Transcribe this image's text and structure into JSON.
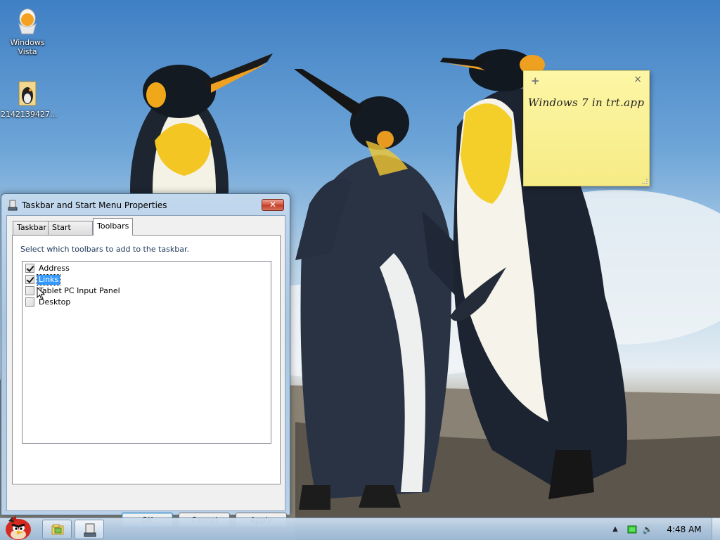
{
  "desktop": {
    "icons": [
      {
        "label": "Windows\nVista",
        "icon": "egg-cup-icon"
      },
      {
        "label": "2142139427...",
        "icon": "image-file-icon"
      }
    ]
  },
  "sticky_note": {
    "add_symbol": "+",
    "close_symbol": "×",
    "text": "Windows 7 in trt.app"
  },
  "dialog": {
    "title": "Taskbar and Start Menu Properties",
    "close_symbol": "✕",
    "tabs": [
      {
        "label": "Taskbar"
      },
      {
        "label": "Start Menu"
      },
      {
        "label": "Toolbars",
        "active": true
      }
    ],
    "instruction": "Select which toolbars to add to the taskbar.",
    "toolbars": [
      {
        "label": "Address",
        "checked": true,
        "selected": false
      },
      {
        "label": "Links",
        "checked": true,
        "selected": true
      },
      {
        "label": "Tablet PC Input Panel",
        "checked": false,
        "selected": false
      },
      {
        "label": "Desktop",
        "checked": false,
        "selected": false
      }
    ],
    "buttons": {
      "ok": "OK",
      "cancel": "Cancel",
      "apply": "Apply"
    }
  },
  "taskbar": {
    "start_icon": "angry-bird-icon",
    "tasks": [
      {
        "icon": "windows-explorer-icon"
      },
      {
        "icon": "taskbar-properties-icon",
        "active": true
      }
    ],
    "tray": {
      "arrow": "▲",
      "network_icon": "network-icon",
      "volume_symbol": "🔊",
      "clock": "4:48 AM"
    }
  },
  "colors": {
    "selection": "#3399ff",
    "sticky_note": "#fdf6a5",
    "close_button": "#c23b22"
  }
}
